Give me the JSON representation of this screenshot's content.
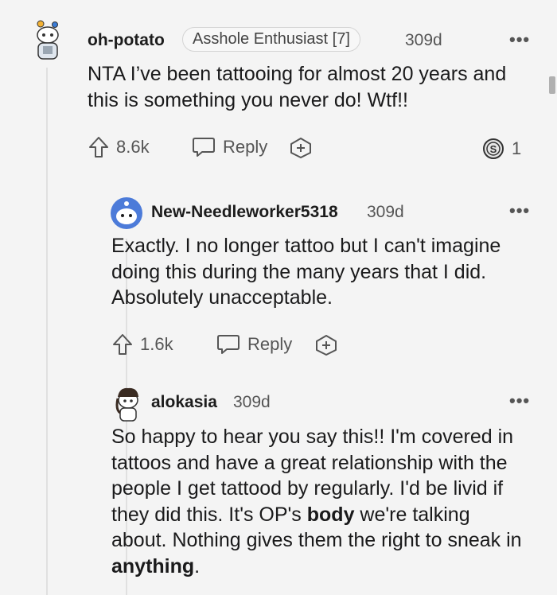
{
  "comments": [
    {
      "username": "oh-potato",
      "flair": "Asshole Enthusiast [7]",
      "time": "309d",
      "more": "•••",
      "body": "NTA I’ve been tattooing for almost 20 years and this is something you never do! Wtf!!",
      "votes": "8.6k",
      "reply_label": "Reply",
      "award_count": "1"
    },
    {
      "username": "New-Needleworker5318",
      "time": "309d",
      "more": "•••",
      "body": "Exactly. I no longer tattoo but I can't imagine doing this during the many years that I did. Absolutely unacceptable.",
      "votes": "1.6k",
      "reply_label": "Reply"
    },
    {
      "username": "alokasia",
      "time": "309d",
      "more": "•••",
      "body_parts": [
        "So happy to hear you say this!! I'm covered in tattoos and have a great relationship with the people I get tattood by regularly. I'd be livid if they did this. It's OP's ",
        "body",
        " we're talking about. Nothing gives them the right to sneak in ",
        "anything",
        "."
      ]
    }
  ],
  "colors": {
    "background": "#f4f4f4",
    "text": "#1a1a1b",
    "muted": "#555555",
    "thread_line": "#e0e0e0",
    "avatar_blue": "#4c7bd9"
  }
}
